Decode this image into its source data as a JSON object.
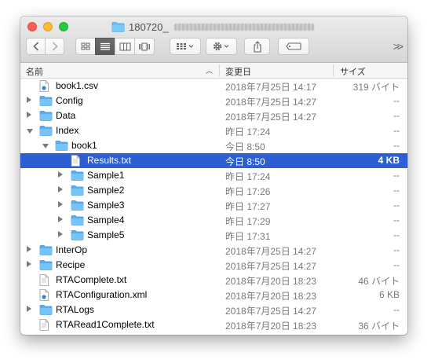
{
  "window": {
    "title": "180720_",
    "title_redacted": true
  },
  "toolbar": {
    "back_icon": "chevron-left-icon",
    "forward_icon": "chevron-right-icon",
    "view_modes": [
      "icon-view-icon",
      "list-view-icon",
      "column-view-icon",
      "cover-flow-icon"
    ],
    "active_view": "list-view-icon",
    "overflow_label": ">>"
  },
  "columns": {
    "name": "名前",
    "date": "変更日",
    "size": "サイズ"
  },
  "colors": {
    "selection": "#2d5fd2",
    "folder": "#5eb6f2"
  },
  "rows": [
    {
      "name": "book1.csv",
      "date": "2018年7月25日 14:17",
      "size": "319 バイト",
      "kind": "doc-blue",
      "indent": 0,
      "disclosure": "none"
    },
    {
      "name": "Config",
      "date": "2018年7月25日 14:27",
      "size": "--",
      "kind": "folder",
      "indent": 0,
      "disclosure": "closed"
    },
    {
      "name": "Data",
      "date": "2018年7月25日 14:27",
      "size": "--",
      "kind": "folder",
      "indent": 0,
      "disclosure": "closed"
    },
    {
      "name": "Index",
      "date": "昨日 17:24",
      "size": "--",
      "kind": "folder",
      "indent": 0,
      "disclosure": "open"
    },
    {
      "name": "book1",
      "date": "今日 8:50",
      "size": "--",
      "kind": "folder",
      "indent": 1,
      "disclosure": "open"
    },
    {
      "name": "Results.txt",
      "date": "今日 8:50",
      "size": "4 KB",
      "kind": "doc",
      "indent": 2,
      "disclosure": "none",
      "selected": true
    },
    {
      "name": "Sample1",
      "date": "昨日 17:24",
      "size": "--",
      "kind": "folder",
      "indent": 2,
      "disclosure": "closed"
    },
    {
      "name": "Sample2",
      "date": "昨日 17:26",
      "size": "--",
      "kind": "folder",
      "indent": 2,
      "disclosure": "closed"
    },
    {
      "name": "Sample3",
      "date": "昨日 17:27",
      "size": "--",
      "kind": "folder",
      "indent": 2,
      "disclosure": "closed"
    },
    {
      "name": "Sample4",
      "date": "昨日 17:29",
      "size": "--",
      "kind": "folder",
      "indent": 2,
      "disclosure": "closed"
    },
    {
      "name": "Sample5",
      "date": "昨日 17:31",
      "size": "--",
      "kind": "folder",
      "indent": 2,
      "disclosure": "closed"
    },
    {
      "name": "InterOp",
      "date": "2018年7月25日 14:27",
      "size": "--",
      "kind": "folder",
      "indent": 0,
      "disclosure": "closed"
    },
    {
      "name": "Recipe",
      "date": "2018年7月25日 14:27",
      "size": "--",
      "kind": "folder",
      "indent": 0,
      "disclosure": "closed"
    },
    {
      "name": "RTAComplete.txt",
      "date": "2018年7月20日 18:23",
      "size": "46 バイト",
      "kind": "doc",
      "indent": 0,
      "disclosure": "none"
    },
    {
      "name": "RTAConfiguration.xml",
      "date": "2018年7月20日 18:23",
      "size": "6 KB",
      "kind": "doc-blue",
      "indent": 0,
      "disclosure": "none"
    },
    {
      "name": "RTALogs",
      "date": "2018年7月25日 14:27",
      "size": "--",
      "kind": "folder",
      "indent": 0,
      "disclosure": "closed"
    },
    {
      "name": "RTARead1Complete.txt",
      "date": "2018年7月20日 18:23",
      "size": "36 バイト",
      "kind": "doc",
      "indent": 0,
      "disclosure": "none"
    }
  ]
}
